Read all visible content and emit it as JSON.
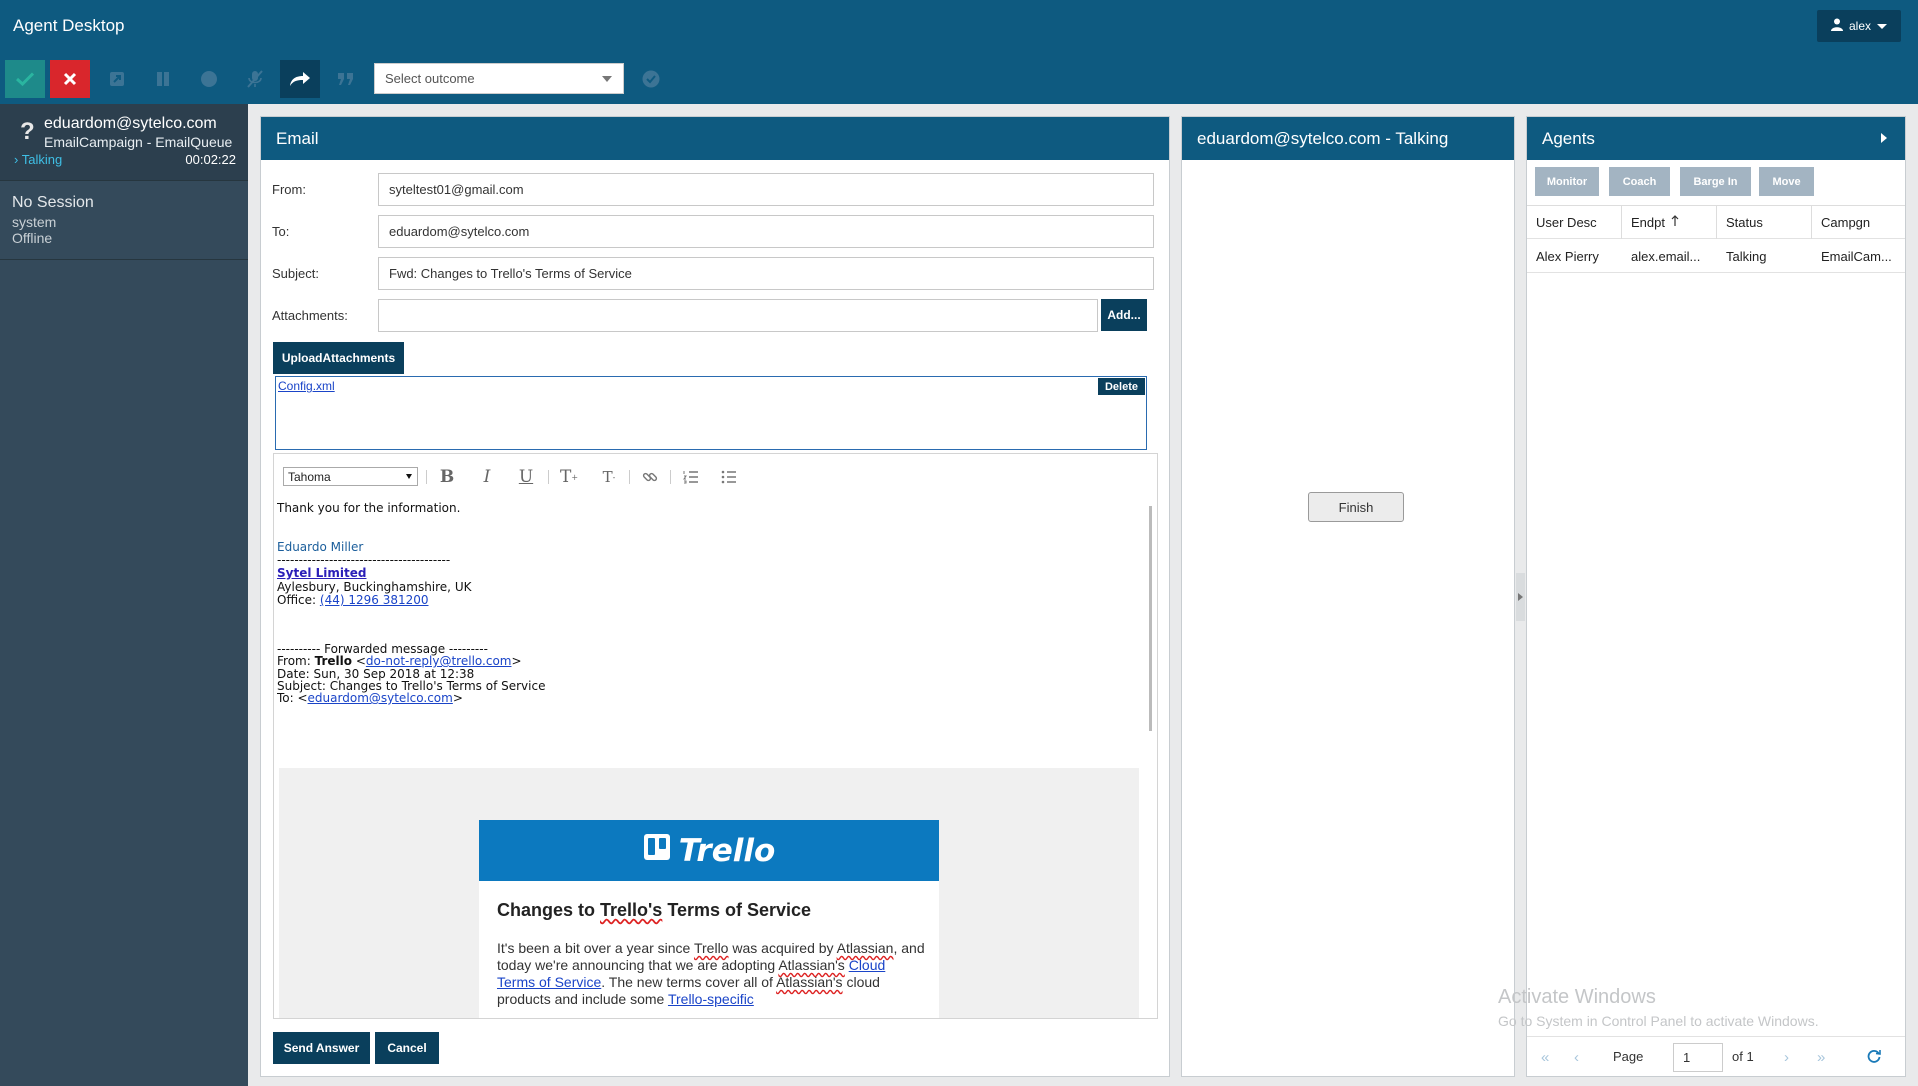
{
  "app": {
    "title": "Agent Desktop",
    "user": "alex"
  },
  "toolbar": {
    "outcome_placeholder": "Select outcome",
    "icons": [
      "check-icon",
      "close-icon",
      "external-link-icon",
      "pause-icon",
      "record-icon",
      "mute-mic-icon",
      "transfer-icon",
      "quote-icon",
      "check-circle-icon"
    ],
    "colors": {
      "accept": "#1e8a8a",
      "reject": "#d9262c",
      "active": "#0a3f5c"
    }
  },
  "sidebar": {
    "active": {
      "email": "eduardom@sytelco.com",
      "campaign": "EmailCampaign - EmailQueue",
      "status": "Talking",
      "timer": "00:02:22"
    },
    "inactive": {
      "title": "No Session",
      "user": "system",
      "status": "Offline"
    }
  },
  "email": {
    "header": "Email",
    "from_label": "From:",
    "from": "syteltest01@gmail.com",
    "to_label": "To:",
    "to": "eduardom@sytelco.com",
    "subject_label": "Subject:",
    "subject": "Fwd: Changes to Trello's Terms of Service",
    "attachments_label": "Attachments:",
    "add_button": "Add...",
    "upload_button": "UploadAttachments",
    "attachment_file": "Config.xml",
    "delete_button": "Delete",
    "font": "Tahoma",
    "body": {
      "thanks": "Thank you for the information.",
      "sig_name": "Eduardo Miller",
      "sig_rule": "----------------------------------------",
      "company": "Sytel Limited",
      "address": "Aylesbury, Buckinghamshire, UK",
      "office_label": "Office: ",
      "office_phone": "(44) 1296 381200",
      "fwd_marker": "---------- Forwarded message ---------",
      "fwd_from_label": "From: ",
      "fwd_from_name": "Trello",
      "fwd_from_email": "do-not-reply@trello.com",
      "fwd_date": "Date: Sun, 30 Sep 2018 at 12:38",
      "fwd_subject": "Subject: Changes to Trello's Terms of Service",
      "fwd_to_label": "To: <",
      "fwd_to_email": "eduardom@sytelco.com",
      "trello_logo": "Trello",
      "trello_heading_a": "Changes to ",
      "trello_heading_b": "Trello's",
      "trello_heading_c": " Terms of Service",
      "trello_p1": "It's been a bit over a year since ",
      "trello_p2": "Trello",
      "trello_p3": " was acquired by ",
      "trello_p4": "Atlassian",
      "trello_p5": ", and today we're announcing that we are adopting ",
      "trello_p6": "Atlassian's",
      "trello_p7": " ",
      "trello_p8": "Cloud Terms of Service",
      "trello_p9": ". The new terms cover all of ",
      "trello_p10": "Atlassian's",
      "trello_p11": " cloud products and include some ",
      "trello_p12": "Trello-specific"
    },
    "send_button": "Send Answer",
    "cancel_button": "Cancel"
  },
  "talk": {
    "header": "eduardom@sytelco.com - Talking",
    "finish_button": "Finish"
  },
  "agents": {
    "header": "Agents",
    "buttons": [
      "Monitor",
      "Coach",
      "Barge In",
      "Move"
    ],
    "columns": [
      "User Desc",
      "Endpt",
      "Status",
      "Campgn"
    ],
    "rows": [
      {
        "user": "Alex Pierry",
        "endpt": "alex.email...",
        "status": "Talking",
        "campaign": "EmailCam..."
      }
    ],
    "pager": {
      "page_label": "Page",
      "page": "1",
      "of_label": "of 1"
    }
  },
  "watermark": {
    "line1": "Activate Windows",
    "line2": "Go to System in Control Panel to activate Windows."
  }
}
